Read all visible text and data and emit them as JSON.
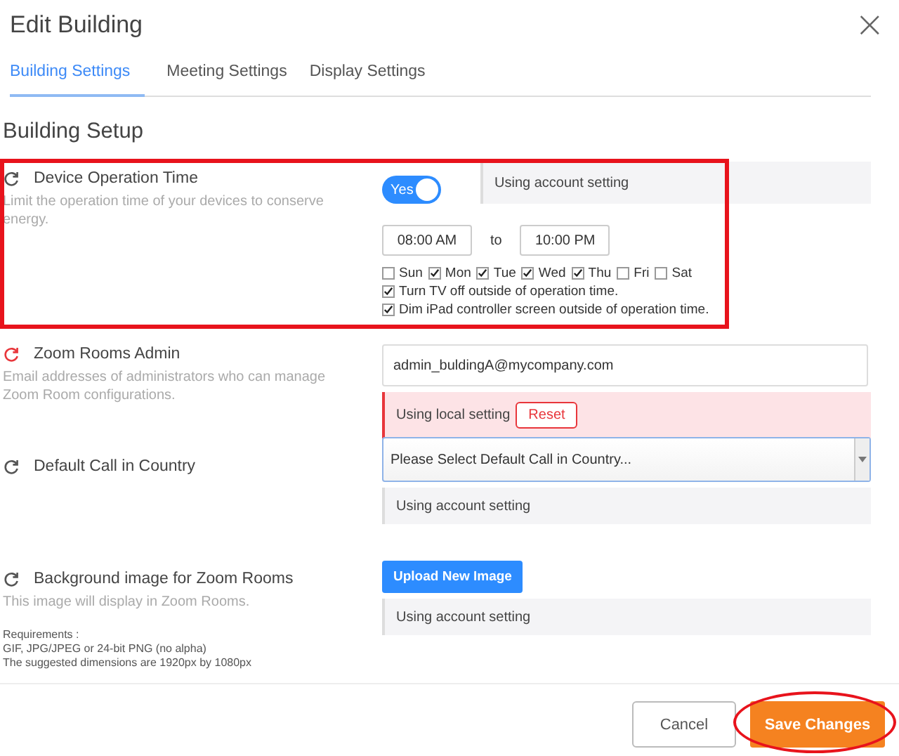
{
  "dialog": {
    "title": "Edit Building",
    "close": "×"
  },
  "tabs": [
    {
      "label": "Building Settings",
      "selected": true
    },
    {
      "label": "Meeting Settings",
      "selected": false
    },
    {
      "label": "Display Settings",
      "selected": false
    }
  ],
  "section_title": "Building Setup",
  "settings": [
    {
      "kind": "schedule",
      "title": "Device Operation Time",
      "description": "Limit the operation time of your devices to conserve energy.",
      "highlighted": true,
      "status": {
        "local": false,
        "text": "Using account setting"
      },
      "toggle": {
        "label": "Yes",
        "on": true
      },
      "from": "08:00 AM",
      "to_label": "to",
      "to": "10:00 PM",
      "days": [
        {
          "label": "Sun",
          "checked": false
        },
        {
          "label": "Mon",
          "checked": true
        },
        {
          "label": "Tue",
          "checked": true
        },
        {
          "label": "Wed",
          "checked": true
        },
        {
          "label": "Thu",
          "checked": true
        },
        {
          "label": "Fri",
          "checked": false
        },
        {
          "label": "Sat",
          "checked": false
        }
      ],
      "options": [
        {
          "label": "Turn TV off outside of operation time.",
          "checked": true
        },
        {
          "label": "Dim iPad controller screen outside of operation time.",
          "checked": true
        }
      ]
    },
    {
      "kind": "email",
      "title": "Zoom Rooms Admin",
      "description": "Email addresses of administrators who can manage Zoom Room configurations.",
      "highlighted": false,
      "status": {
        "local": true,
        "text": "Using local setting",
        "reset": "Reset"
      },
      "value": "admin_buldingA@mycompany.com"
    },
    {
      "kind": "select",
      "title": "Default Call in Country",
      "highlighted": false,
      "status": {
        "local": false,
        "text": "Using account setting"
      },
      "value": "Please Select Default Call in Country..."
    },
    {
      "kind": "upload",
      "title": "Background image for Zoom Rooms",
      "description": "This image will display in Zoom Rooms.",
      "requirements": [
        "Requirements :",
        "GIF, JPG/JPEG or 24-bit PNG (no alpha)",
        "The suggested dimensions are 1920px by 1080px"
      ],
      "highlighted": false,
      "status": {
        "local": false,
        "text": "Using account setting"
      },
      "button": "Upload New Image"
    }
  ],
  "footer": {
    "cancel": "Cancel",
    "save": "Save Changes",
    "save_highlighted": true
  }
}
